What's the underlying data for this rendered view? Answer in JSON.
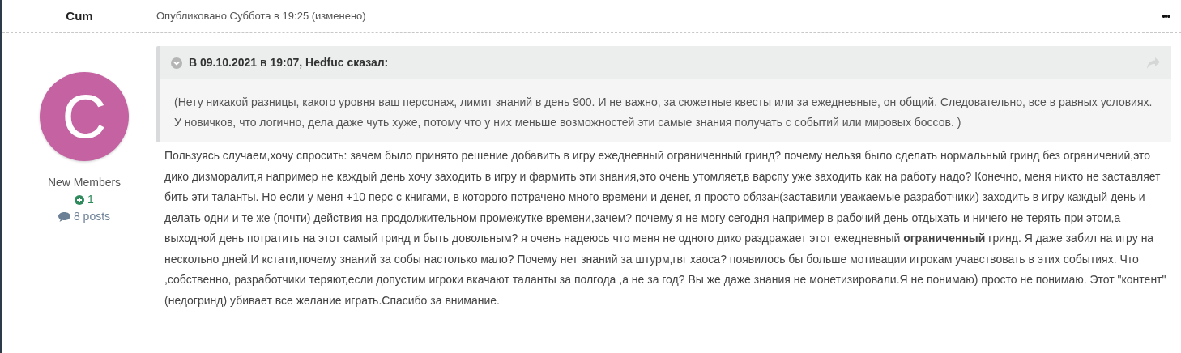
{
  "author": {
    "name": "Cum",
    "avatar_letter": "C",
    "group": "New Members",
    "reputation": "1",
    "posts": "8 posts"
  },
  "post_meta": "Опубликовано Суббота в 19:25 (изменено)",
  "menu_button": "•••",
  "quote": {
    "citation": "В 09.10.2021 в 19:07, Hedfuc сказал:",
    "text": "(Нету никакой разницы, какого уровня ваш персонаж, лимит знаний в день 900. И не важно, за сюжетные квесты или за ежедневные, он общий. Следовательно, все в равных условиях. У новичков, что логично, дела даже чуть хуже, потому что у них меньше возможностей эти самые знания получать с событий или мировых боссов. )"
  },
  "body": [
    {
      "kind": "text",
      "text": "Пользуясь случаем,хочу спросить: зачем было принято решение добавить в игру ежедневный ограниченный гринд? почему нельзя было сделать нормальный гринд без ограничений,это дико дизморалит,я например не каждый день хочу заходить в игру и фармить эти знания,это очень утомляет,в варспу уже заходить как на работу надо? Конечно, меня никто не заставляет бить эти таланты. Но если у меня +10 перс с книгами, в которого потрачено много времени и денег, я просто "
    },
    {
      "kind": "underline",
      "text": "обязан"
    },
    {
      "kind": "text",
      "text": "(заставили уважаемые разработчики) заходить в игру каждый день и делать одни и те же (почти) действия на продолжительном промежутке времени,зачем? почему я не могу сегодня например в рабочий день отдыхать и ничего не терять при этом,а выходной день потратить на этот самый гринд и быть довольным? я очень надеюсь что меня не одного дико раздражает этот ежедневный **ограниченный** гринд. Я даже забил на игру на нескольно дней.И кстати,почему знаний за собы настолько мало? Почему нет знаний за штурм,гвг хаоса? появилось бы больше мотивации игрокам учавствовать в этих событиях. Что ,собственно, разработчики теряют,если допустим игроки вкачают таланты за полгода ,а не за год? Вы же даже знания не монетизировали.Я не понимаю) просто не понимаю. Этот \"контент\" (недогринд) убивает все желание играть.Спасибо за внимание."
    }
  ]
}
